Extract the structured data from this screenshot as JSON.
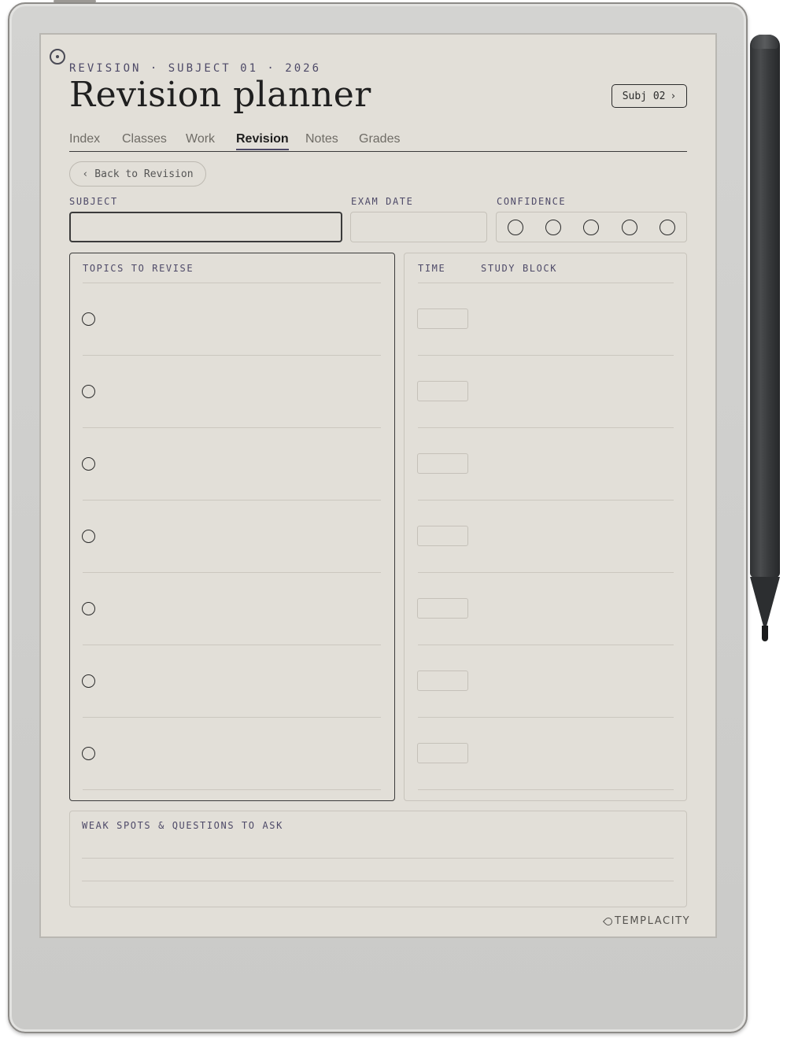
{
  "page": {
    "eyebrow": "REVISION · SUBJECT 01 · 2026",
    "title": "Revision planner",
    "next_subject": "Subj 02",
    "next_arrow": "›"
  },
  "tabs": [
    {
      "label": "Index",
      "active": false
    },
    {
      "label": "Classes",
      "active": false
    },
    {
      "label": "Work",
      "active": false
    },
    {
      "label": "Revision",
      "active": true
    },
    {
      "label": "Notes",
      "active": false
    },
    {
      "label": "Grades",
      "active": false
    }
  ],
  "back": {
    "arrow": "‹",
    "label": "Back to Revision"
  },
  "fields": {
    "subject_label": "SUBJECT",
    "subject_value": "",
    "exam_date_label": "EXAM DATE",
    "exam_date_value": "",
    "confidence_label": "CONFIDENCE",
    "confidence_max": 5,
    "confidence_value": 0
  },
  "topics": {
    "heading": "TOPICS TO REVISE",
    "rows": [
      "",
      "",
      "",
      "",
      "",
      "",
      ""
    ]
  },
  "study": {
    "time_heading": "TIME",
    "block_heading": "STUDY BLOCK",
    "rows": [
      {
        "time": "",
        "block": ""
      },
      {
        "time": "",
        "block": ""
      },
      {
        "time": "",
        "block": ""
      },
      {
        "time": "",
        "block": ""
      },
      {
        "time": "",
        "block": ""
      },
      {
        "time": "",
        "block": ""
      },
      {
        "time": "",
        "block": ""
      }
    ]
  },
  "weak": {
    "heading": "WEAK SPOTS & QUESTIONS TO ASK",
    "lines": [
      "",
      ""
    ]
  },
  "brand": "TEMPLACITY",
  "colors": {
    "paper": "#e2dfd8",
    "accent": "#4e4a68",
    "ink": "#1f1f1f"
  }
}
